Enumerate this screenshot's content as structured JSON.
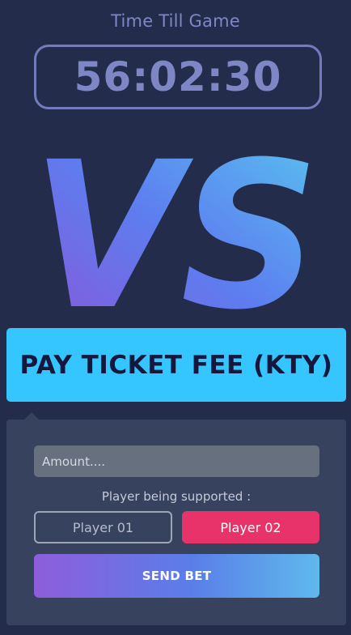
{
  "timer": {
    "label": "Time Till Game",
    "value": "56:02:30"
  },
  "versus": {
    "text": "VS",
    "gradient": [
      "#8a55d6",
      "#5d7ef0",
      "#58c6ef"
    ]
  },
  "pay_button": {
    "label": "PAY TICKET FEE (KTY)",
    "color": "#35c6ff"
  },
  "bet_panel": {
    "amount_placeholder": "Amount....",
    "support_label": "Player being supported :",
    "players": [
      {
        "label": "Player 01",
        "selected": false
      },
      {
        "label": "Player 02",
        "selected": true,
        "color": "#e8336a"
      }
    ],
    "send_label": "SEND BET"
  },
  "colors": {
    "background": "#232d4b",
    "panel": "#37425e",
    "accent_timer": "#7f86c6"
  }
}
